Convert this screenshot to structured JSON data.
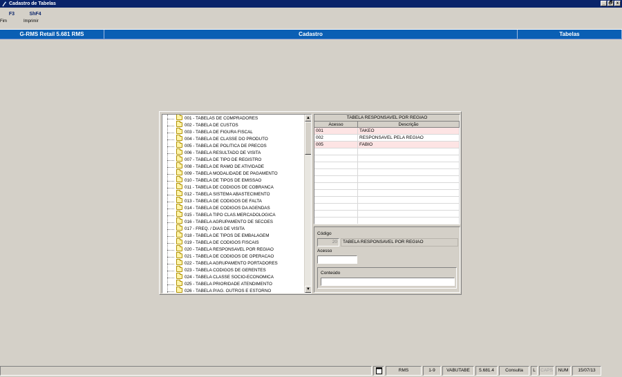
{
  "window": {
    "title": "Cadastro de Tabelas",
    "controls": [
      "_",
      "🗗",
      "x"
    ]
  },
  "fkeys": [
    {
      "key": "F3",
      "label": "Fim"
    },
    {
      "key": "ShF4",
      "label": "Imprimir"
    }
  ],
  "header": {
    "app": "G-RMS Retail 5.681 RMS",
    "module": "Cadastro",
    "section": "Tabelas"
  },
  "tree": {
    "items": [
      "001 - TABELAS DE COMPRADORES",
      "002 - TABELA DE CUSTOS",
      "003 - TABELA DE FIGURA FISCAL",
      "004 - TABELA DE CLASSE DO PRODUTO",
      "005 - TABELA DE POLITICA DE PRECOS",
      "006 - TABELA RESULTADO DE VISITA",
      "007 - TABELA DE TIPO DE REGISTRO",
      "008 - TABELA DE RAMO DE ATIVIDADE",
      "009 - TABELA MODALIDADE DE PAGAMENTO",
      "010 - TABELA DE TIPOS DE EMISSAO",
      "011 - TABELA DE CODIGOS DE COBRANCA",
      "012 - TABELA SISTEMA ABASTECIMENTO",
      "013 - TABELA DE CODIGOS DE FALTA",
      "014 - TABELA DE CODIGOS DA AGENDAS",
      "015 - TABELA TIPO CLAS.MERCADOLOGICA",
      "016 - TABELA AGRUPAMENTO DE SECOES",
      "017 - FREQ. / DIAS DE VISITA",
      "018 - TABELA DE TIPOS DE EMBALAGEM",
      "019 - TABELA DE CODIGOS FISCAIS",
      "020 - TABELA RESPONSAVEL POR REGIAO",
      "021 - TABELA DE CODIGOS DE OPERACAO",
      "022 - TABELA AGRUPAMENTO PORTADORES",
      "023 - TABELA CODIGOS DE GERENTES",
      "024 - TABELA CLASSE SOCIO-ECONOMICA",
      "025 - TABELA PRIORIDADE ATENDIMENTO",
      "026 - TABELA P/AG. OUTROS E ESTORNO"
    ]
  },
  "grid": {
    "title": "TABELA RESPONSAVEL POR REGIAO",
    "columns": [
      "Acesso",
      "Descrição"
    ],
    "rows": [
      [
        "001",
        "TAKEO"
      ],
      [
        "002",
        "RESPONSAVEL PELA REGIAO"
      ],
      [
        "005",
        "FABIO"
      ]
    ]
  },
  "form": {
    "codigo_label": "Código",
    "codigo_value": "20",
    "codigo_desc": "TABELA RESPONSAVEL POR REGIAO",
    "acesso_label": "Acesso",
    "acesso_value": "",
    "conteudo_label": "Conteúdo",
    "conteudo_value": ""
  },
  "status": {
    "system": "RMS",
    "pages": "1-9",
    "program": "VABUTABE",
    "version": "5.681.4",
    "mode": "Consulta",
    "l": "L",
    "caps": "CAPS",
    "num": "NUM",
    "date": "15/07/13"
  }
}
